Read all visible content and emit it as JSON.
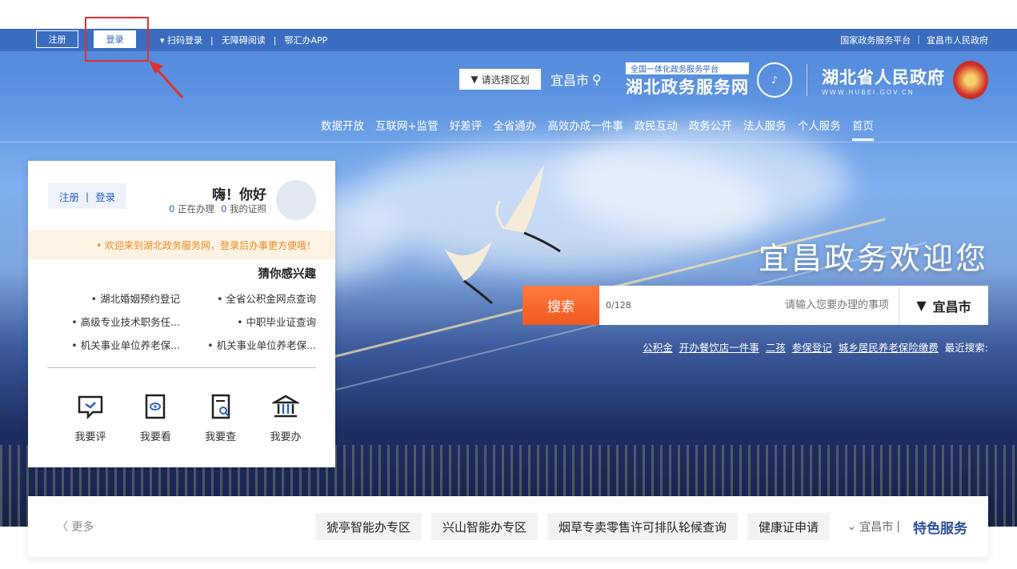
{
  "topbar": {
    "register": "注册",
    "login": "登录",
    "scan_login": "▾ 扫码登录",
    "accessible": "无障碍阅读",
    "app": "鄂汇办APP",
    "right_links": [
      "国家政务服务平台",
      "宜昌市人民政府"
    ]
  },
  "header": {
    "gov_name": "湖北省人民政府",
    "gov_en": "WWW.HUBEI.GOV.CN",
    "service_tag": "全国一体化政务服务平台",
    "service_name": "湖北政务服务网",
    "region_select": "请选择区划",
    "region_current": "宜昌市"
  },
  "nav": {
    "items": [
      "首页",
      "个人服务",
      "法人服务",
      "政务公开",
      "政民互动",
      "高效办成一件事",
      "全省通办",
      "好差评",
      "互联网+监管",
      "数据开放"
    ]
  },
  "hero": {
    "welcome": "宜昌政务欢迎您",
    "search_city": "宜昌市",
    "search_placeholder": "请输入您要办理的事项",
    "search_count": "0/128",
    "search_button": "搜索",
    "hot_label": "最近搜索:",
    "hot_keywords": [
      "城乡居民养老保险缴费",
      "参保登记",
      "二孩",
      "开办餐饮店一件事",
      "公积金"
    ]
  },
  "user_panel": {
    "greeting": "嗨！你好",
    "certs_label": "我的证照",
    "certs_count": "0",
    "doing_label": "正在办理",
    "doing_count": "0",
    "login": "登录",
    "register": "注册",
    "notice": "• 欢迎来到湖北政务服务网，登录后办事更方便哦！",
    "guess_title": "猜你感兴趣",
    "guess_items": [
      "• 全省公积金网点查询",
      "• 湖北婚姻预约登记",
      "• 中职毕业证查询",
      "• 高级专业技术职务任...",
      "• 机关事业单位养老保...",
      "• 机关事业单位养老保..."
    ],
    "actions": [
      "我要办",
      "我要查",
      "我要看",
      "我要评"
    ]
  },
  "feature": {
    "brand": "特色服务",
    "city": "宜昌市",
    "tags": [
      "健康证申请",
      "烟草专卖零售许可排队轮候查询",
      "兴山智能办专区",
      "猇亭智能办专区"
    ],
    "more": "〈 更多"
  },
  "colors": {
    "primary": "#2d62c4",
    "search_orange": "#f05a1f",
    "notice_text": "#e98a2a",
    "highlight": "#e03030"
  }
}
